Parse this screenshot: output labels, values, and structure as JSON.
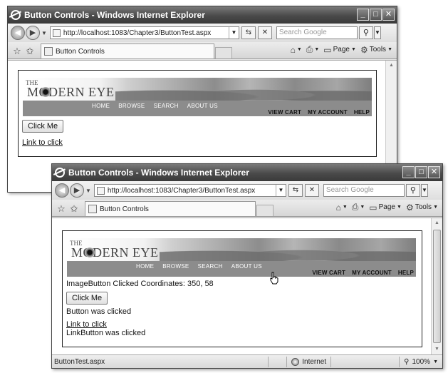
{
  "windows": [
    {
      "title": "Button Controls - Windows Internet Explorer",
      "address": "http://localhost:1083/Chapter3/ButtonTest.aspx",
      "search_placeholder": "Search Google",
      "tab_label": "Button Controls",
      "commands": {
        "page": "Page",
        "tools": "Tools"
      },
      "banner": {
        "logo_small": "THE",
        "logo": "MODERN EYE",
        "main_nav": [
          "HOME",
          "BROWSE",
          "SEARCH",
          "ABOUT US"
        ],
        "sub_nav": [
          "VIEW CART",
          "MY ACCOUNT",
          "HELP"
        ]
      },
      "button_label": "Click Me",
      "link_label": "Link to click"
    },
    {
      "title": "Button Controls - Windows Internet Explorer",
      "address": "http://localhost:1083/Chapter3/ButtonTest.aspx",
      "search_placeholder": "Search Google",
      "tab_label": "Button Controls",
      "commands": {
        "page": "Page",
        "tools": "Tools"
      },
      "banner": {
        "logo_small": "THE",
        "logo": "MODERN EYE",
        "main_nav": [
          "HOME",
          "BROWSE",
          "SEARCH",
          "ABOUT US"
        ],
        "sub_nav": [
          "VIEW CART",
          "MY ACCOUNT",
          "HELP"
        ]
      },
      "coordinates_text": "ImageButton Clicked Coordinates: 350, 58",
      "button_label": "Click Me",
      "button_message": "Button was clicked",
      "link_label": "Link to click",
      "link_message": "LinkButton was clicked",
      "status": {
        "text": "ButtonTest.aspx",
        "zone": "Internet",
        "zoom": "100%"
      }
    }
  ],
  "icons": {
    "back": "back-arrow-icon",
    "forward": "forward-arrow-icon",
    "refresh": "refresh-icon",
    "stop": "stop-icon",
    "search": "search-magnifier-icon",
    "favorites": "favorites-star-icon",
    "add_favorites": "add-favorites-icon",
    "home": "home-icon",
    "print": "print-icon",
    "page": "page-icon",
    "tools": "gear-icon",
    "globe": "internet-globe-icon",
    "zoom": "zoom-icon",
    "cursor": "hand-cursor-icon"
  }
}
